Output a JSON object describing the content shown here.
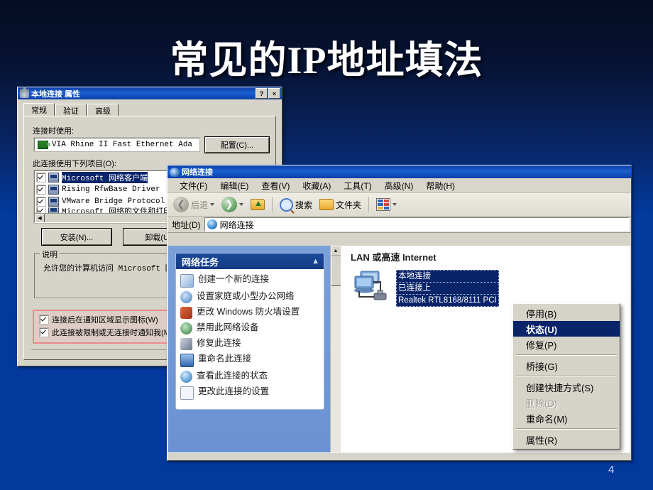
{
  "slide": {
    "title": "常见的IP地址填法",
    "number": "4"
  },
  "properties_dialog": {
    "title": "本地连接 属性",
    "icon": "network-connection-icon",
    "help_button": "?",
    "close_button": "×",
    "tabs": [
      {
        "label": "常规",
        "active": true
      },
      {
        "label": "验证",
        "active": false
      },
      {
        "label": "高级",
        "active": false
      }
    ],
    "connect_using_label": "连接时使用:",
    "adapter_name": "VIA Rhine II Fast Ethernet Ada",
    "configure_button": "配置(C)...",
    "components_label": "此连接使用下列项目(O):",
    "components": [
      {
        "label": "Microsoft 网络客户端",
        "checked": true,
        "selected": true
      },
      {
        "label": "Rising RfwBase Driver",
        "checked": true,
        "selected": false
      },
      {
        "label": "VMware Bridge Protocol",
        "checked": true,
        "selected": false
      },
      {
        "label": "Microsoft 网络的文件和打印",
        "checked": true,
        "selected": false
      }
    ],
    "install_button": "安装(N)...",
    "uninstall_button": "卸载(U)",
    "description_group": "说明",
    "description_text": "允许您的计算机访问 Microsoft 网",
    "options": [
      {
        "label": "连接后在通知区域显示图标(W)",
        "checked": true
      },
      {
        "label": "此连接被限制或无连接时通知我(M",
        "checked": true
      }
    ]
  },
  "explorer_window": {
    "title": "网络连接",
    "menus": [
      {
        "label": "文件(F)"
      },
      {
        "label": "编辑(E)"
      },
      {
        "label": "查看(V)"
      },
      {
        "label": "收藏(A)"
      },
      {
        "label": "工具(T)"
      },
      {
        "label": "高级(N)"
      },
      {
        "label": "帮助(H)"
      }
    ],
    "toolbar": {
      "back_label": "后退",
      "forward_label": "",
      "up_label": "",
      "search_label": "搜索",
      "folders_label": "文件夹",
      "views_label": ""
    },
    "address": {
      "label": "地址(D)",
      "value": "网络连接"
    },
    "task_panel": {
      "header": "网络任务",
      "collapse_icon": "chevron-up-icon",
      "items": [
        {
          "label": "创建一个新的连接",
          "icon": "new-connection-icon",
          "color": "#8fb4dd"
        },
        {
          "label": "设置家庭或小型办公网络",
          "icon": "home-network-icon",
          "color": "#5b8ec4"
        },
        {
          "label": "更改 Windows 防火墙设置",
          "icon": "firewall-icon",
          "color": "#c94b2c"
        },
        {
          "label": "禁用此网络设备",
          "icon": "disable-device-icon",
          "color": "#3f8f4a"
        },
        {
          "label": "修复此连接",
          "icon": "repair-icon",
          "color": "#7b8798"
        },
        {
          "label": "重命名此连接",
          "icon": "rename-icon",
          "color": "#3a6fb5"
        },
        {
          "label": "查看此连接的状态",
          "icon": "status-icon",
          "color": "#2f86c4"
        },
        {
          "label": "更改此连接的设置",
          "icon": "settings-icon",
          "color": "#d9e2f2"
        }
      ]
    },
    "content": {
      "group_header": "LAN 或高速 Internet",
      "connection": {
        "name": "本地连接",
        "status": "已连接上",
        "device": "Realtek RTL8168/8111 PCI"
      }
    }
  },
  "context_menu": {
    "items": [
      {
        "label": "停用(B)",
        "state": "normal"
      },
      {
        "label": "状态(U)",
        "state": "selected"
      },
      {
        "label": "修复(P)",
        "state": "normal"
      },
      {
        "label": "",
        "state": "separator"
      },
      {
        "label": "桥接(G)",
        "state": "normal"
      },
      {
        "label": "",
        "state": "separator"
      },
      {
        "label": "创建快捷方式(S)",
        "state": "normal"
      },
      {
        "label": "删除(D)",
        "state": "disabled"
      },
      {
        "label": "重命名(M)",
        "state": "normal"
      },
      {
        "label": "",
        "state": "separator"
      },
      {
        "label": "属性(R)",
        "state": "normal"
      }
    ]
  },
  "colors": {
    "slide_background_top": "#050d22",
    "slide_background_bottom": "#03389c",
    "titlebar_blue": "#0b3fa8",
    "selection_blue": "#0a246a",
    "task_panel_header": "#143b82",
    "highlight_red": "#e88b8b"
  }
}
